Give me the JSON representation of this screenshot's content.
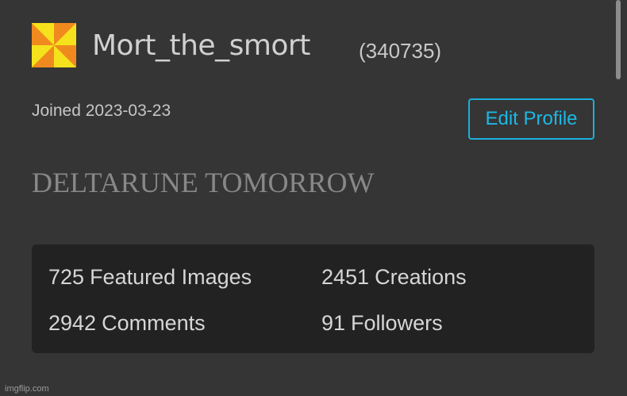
{
  "profile": {
    "username": "Mort_the_smort",
    "user_id": "(340735)",
    "joined": "Joined 2023-03-23",
    "edit_button": "Edit Profile",
    "bio": "DELTARUNE TOMORROW",
    "avatar_colors": [
      "#f5e21c",
      "#f08a1f"
    ]
  },
  "stats": {
    "featured_images": {
      "count": "725",
      "label": "Featured Images"
    },
    "creations": {
      "count": "2451",
      "label": "Creations"
    },
    "comments": {
      "count": "2942",
      "label": "Comments"
    },
    "followers": {
      "count": "91",
      "label": "Followers"
    }
  },
  "watermark": "imgflip.com",
  "colors": {
    "background": "#353535",
    "stats_panel": "#222222",
    "accent": "#1bb8e6"
  }
}
